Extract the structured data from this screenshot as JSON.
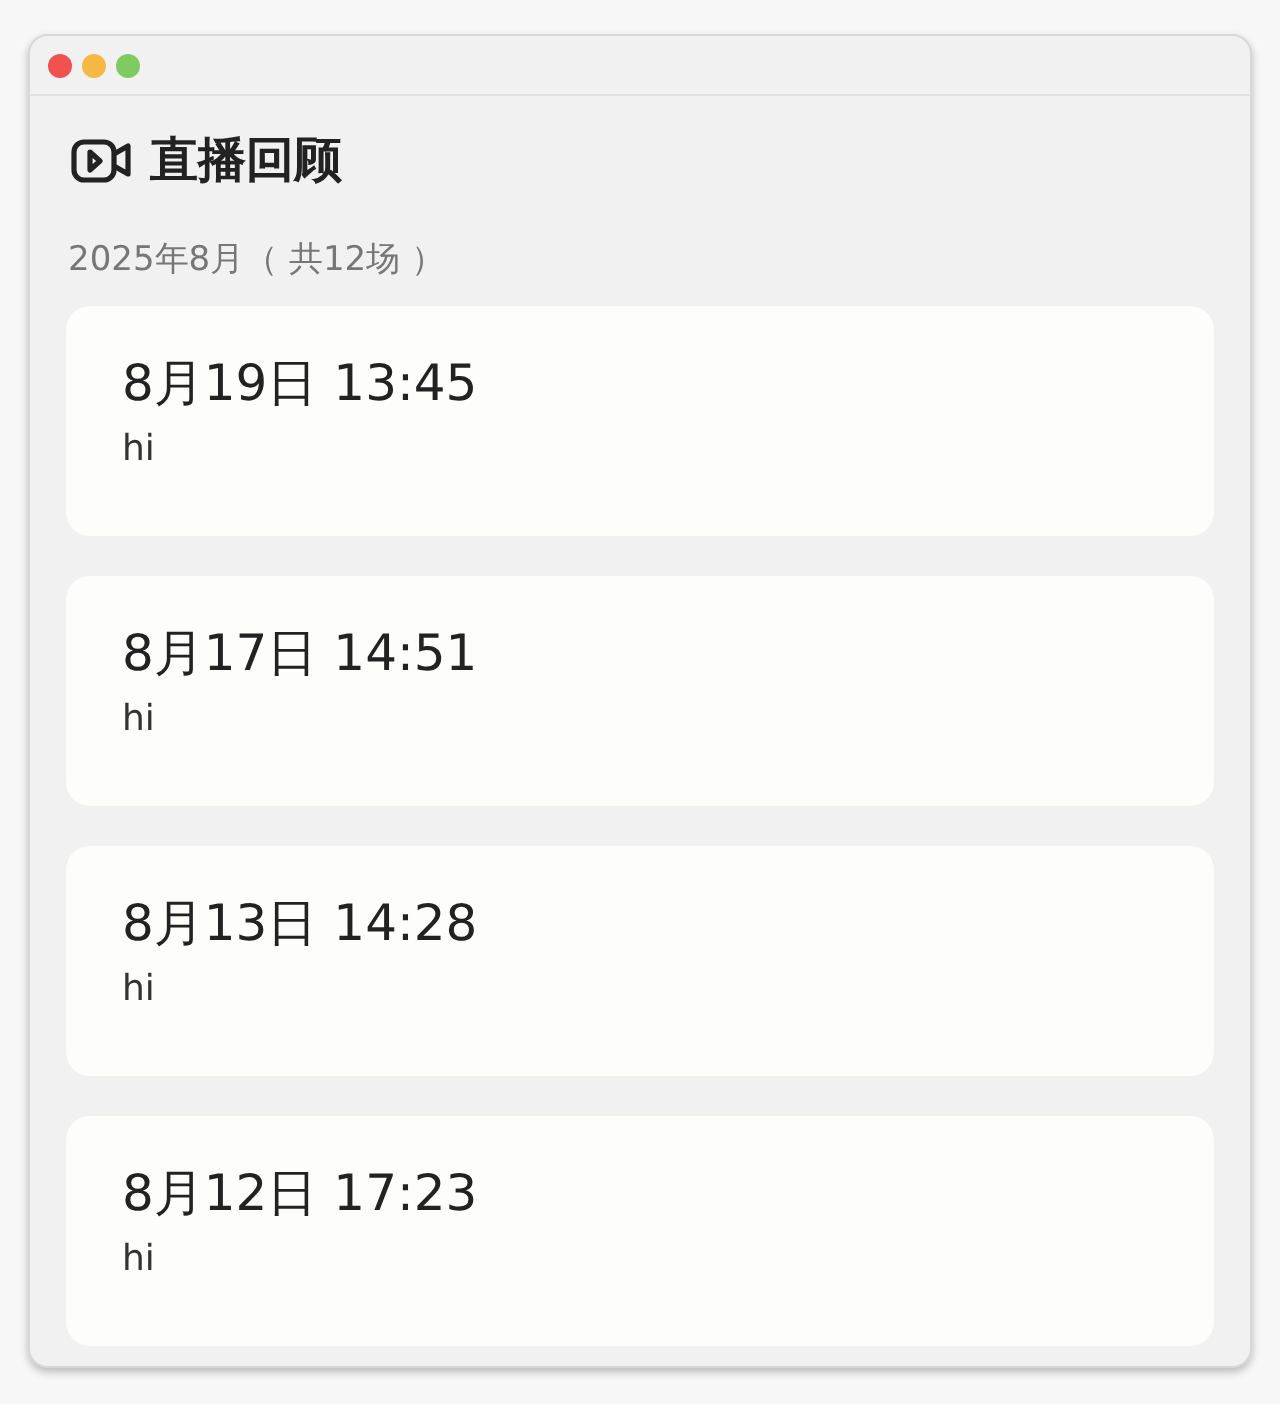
{
  "window": {
    "controls": [
      {
        "color": "#f0524f"
      },
      {
        "color": "#f5b845"
      },
      {
        "color": "#7ecb5f"
      }
    ]
  },
  "header": {
    "title": "直播回顾"
  },
  "section": {
    "label": "2025年8月（ 共12场 ）"
  },
  "sessions": [
    {
      "time": "8月19日 13:45",
      "note": "hi"
    },
    {
      "time": "8月17日 14:51",
      "note": "hi"
    },
    {
      "time": "8月13日 14:28",
      "note": "hi"
    },
    {
      "time": "8月12日 17:23",
      "note": "hi"
    }
  ]
}
